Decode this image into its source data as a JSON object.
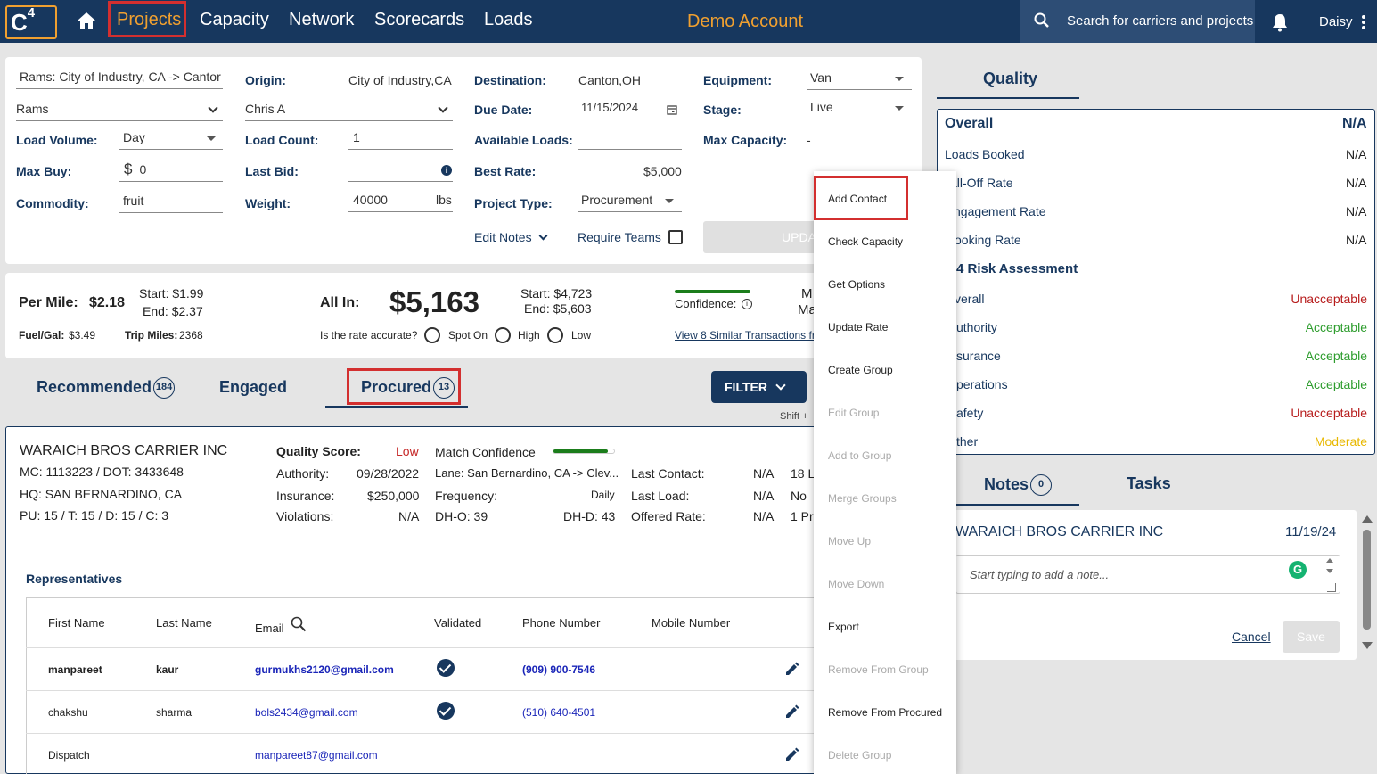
{
  "nav": {
    "logo": "C",
    "logo_sup": "4",
    "links": [
      "Projects",
      "Capacity",
      "Network",
      "Scorecards",
      "Loads"
    ],
    "account": "Demo Account",
    "search_placeholder": "Search for carriers and projects",
    "user": "Daisy"
  },
  "project": {
    "name": "Rams: City of Industry, CA -> Cantor",
    "customer": "Rams",
    "load_volume_label": "Load Volume:",
    "load_volume": "Day",
    "max_buy_label": "Max Buy:",
    "max_buy_currency": "$",
    "max_buy": "0",
    "commodity_label": "Commodity:",
    "commodity": "fruit",
    "origin_label": "Origin:",
    "origin": "City of Industry,CA",
    "owner": "Chris A",
    "load_count_label": "Load Count:",
    "load_count": "1",
    "last_bid_label": "Last Bid:",
    "weight_label": "Weight:",
    "weight": "40000",
    "weight_unit": "lbs",
    "destination_label": "Destination:",
    "destination": "Canton,OH",
    "due_date_label": "Due Date:",
    "due_date": "11/15/2024",
    "available_loads_label": "Available Loads:",
    "best_rate_label": "Best Rate:",
    "best_rate": "$5,000",
    "project_type_label": "Project Type:",
    "project_type": "Procurement",
    "edit_notes": "Edit Notes",
    "require_teams": "Require Teams",
    "equipment_label": "Equipment:",
    "equipment": "Van",
    "stage_label": "Stage:",
    "stage": "Live",
    "max_capacity_label": "Max Capacity:",
    "max_capacity": "-",
    "update_button": "UPDA"
  },
  "rates": {
    "per_mile_label": "Per Mile:",
    "per_mile": "$2.18",
    "pm_start": "Start: $1.99",
    "pm_end": "End: $2.37",
    "fuel_label": "Fuel/Gal:",
    "fuel": "$3.49",
    "trip_label": "Trip Miles:",
    "trip": "2368",
    "all_in_label": "All In:",
    "all_in": "$5,163",
    "ai_start": "Start: $4,723",
    "ai_end": "End: $5,603",
    "accurate_q": "Is the rate accurate?",
    "opt_spot": "Spot On",
    "opt_high": "High",
    "opt_low": "Low",
    "confidence": "Confidence:",
    "similar_link": "View 8 Similar Transactions fr",
    "cut_m1": "M",
    "cut_m2": "Ma"
  },
  "tabs": {
    "recommended": "Recommended",
    "recommended_count": "184",
    "engaged": "Engaged",
    "procured": "Procured",
    "procured_count": "13",
    "filter": "FILTER",
    "shift_hint": "Shift +"
  },
  "carrier": {
    "name": "WARAICH BROS CARRIER INC",
    "mc_dot": "MC: 1113223 / DOT: 3433648",
    "hq": "HQ:  SAN BERNARDINO, CA",
    "pu": "PU: 15  /  T: 15  /  D: 15 / C: 3",
    "quality_label": "Quality Score:",
    "quality": "Low",
    "authority_label": "Authority:",
    "authority": "09/28/2022",
    "insurance_label": "Insurance:",
    "insurance": "$250,000",
    "violations_label": "Violations:",
    "violations": "N/A",
    "match_label": "Match Confidence",
    "match_level": 0.9,
    "lane": "Lane: San Bernardino, CA -> Clev...",
    "frequency_label": "Frequency:",
    "frequency": "Daily",
    "dho": "DH-O: 39",
    "dhd": "DH-D: 43",
    "last_contact_label": "Last Contact:",
    "last_contact": "N/A",
    "last_load_label": "Last Load:",
    "last_load": "N/A",
    "offered_label": "Offered Rate:",
    "offered": "N/A",
    "cut1": "18 L",
    "cut2": "No ",
    "cut3": "1 Pr"
  },
  "reps": {
    "title": "Representatives",
    "headers": [
      "First Name",
      "Last Name",
      "Email",
      "Validated",
      "Phone Number",
      "Mobile Number"
    ],
    "rows": [
      {
        "first": "manpareet",
        "last": "kaur",
        "email": "gurmukhs2120@gmail.com",
        "phone": "(909) 900-7546"
      },
      {
        "first": "chakshu",
        "last": "sharma",
        "email": "bols2434@gmail.com",
        "phone": "(510) 640-4501"
      },
      {
        "first": "Dispatch",
        "last": "",
        "email": "manpareet87@gmail.com",
        "phone": ""
      }
    ]
  },
  "menu": [
    {
      "label": "Add Contact",
      "enabled": true
    },
    {
      "label": "Check Capacity",
      "enabled": true
    },
    {
      "label": "Get Options",
      "enabled": true
    },
    {
      "label": "Update Rate",
      "enabled": true
    },
    {
      "label": "Create Group",
      "enabled": true
    },
    {
      "label": "Edit Group",
      "enabled": false
    },
    {
      "label": "Add to Group",
      "enabled": false
    },
    {
      "label": "Merge Groups",
      "enabled": false
    },
    {
      "label": "Move Up",
      "enabled": false
    },
    {
      "label": "Move Down",
      "enabled": false
    },
    {
      "label": "Export",
      "enabled": true
    },
    {
      "label": "Remove From Group",
      "enabled": false
    },
    {
      "label": "Remove From Procured",
      "enabled": true
    },
    {
      "label": "Delete Group",
      "enabled": false
    }
  ],
  "quality": {
    "tab": "Quality",
    "overall_label": "Overall",
    "overall_value": "N/A",
    "rows": [
      {
        "label": "Loads Booked",
        "value": "N/A"
      },
      {
        "label": "all-Off Rate",
        "value": "N/A"
      },
      {
        "label": "ngagement Rate",
        "value": "N/A"
      },
      {
        "label": "ooking Rate",
        "value": "N/A"
      }
    ],
    "risk_title": "4 Risk Assessment",
    "risk": [
      {
        "label": "verall",
        "value": "Unacceptable"
      },
      {
        "label": "uthority",
        "value": "Acceptable"
      },
      {
        "label": "surance",
        "value": "Acceptable"
      },
      {
        "label": "perations",
        "value": "Acceptable"
      },
      {
        "label": "afety",
        "value": "Unacceptable"
      },
      {
        "label": "ther",
        "value": "Moderate"
      }
    ],
    "colors": {
      "Unacceptable": "#b71c1c",
      "Acceptable": "#2e9d2e",
      "Moderate": "#e8b800"
    }
  },
  "notes": {
    "tab": "Notes",
    "count": "0",
    "tasks": "Tasks",
    "carrier": "WARAICH BROS CARRIER INC",
    "date": "11/19/24",
    "placeholder": "Start typing to add a note...",
    "cancel": "Cancel",
    "save": "Save"
  }
}
